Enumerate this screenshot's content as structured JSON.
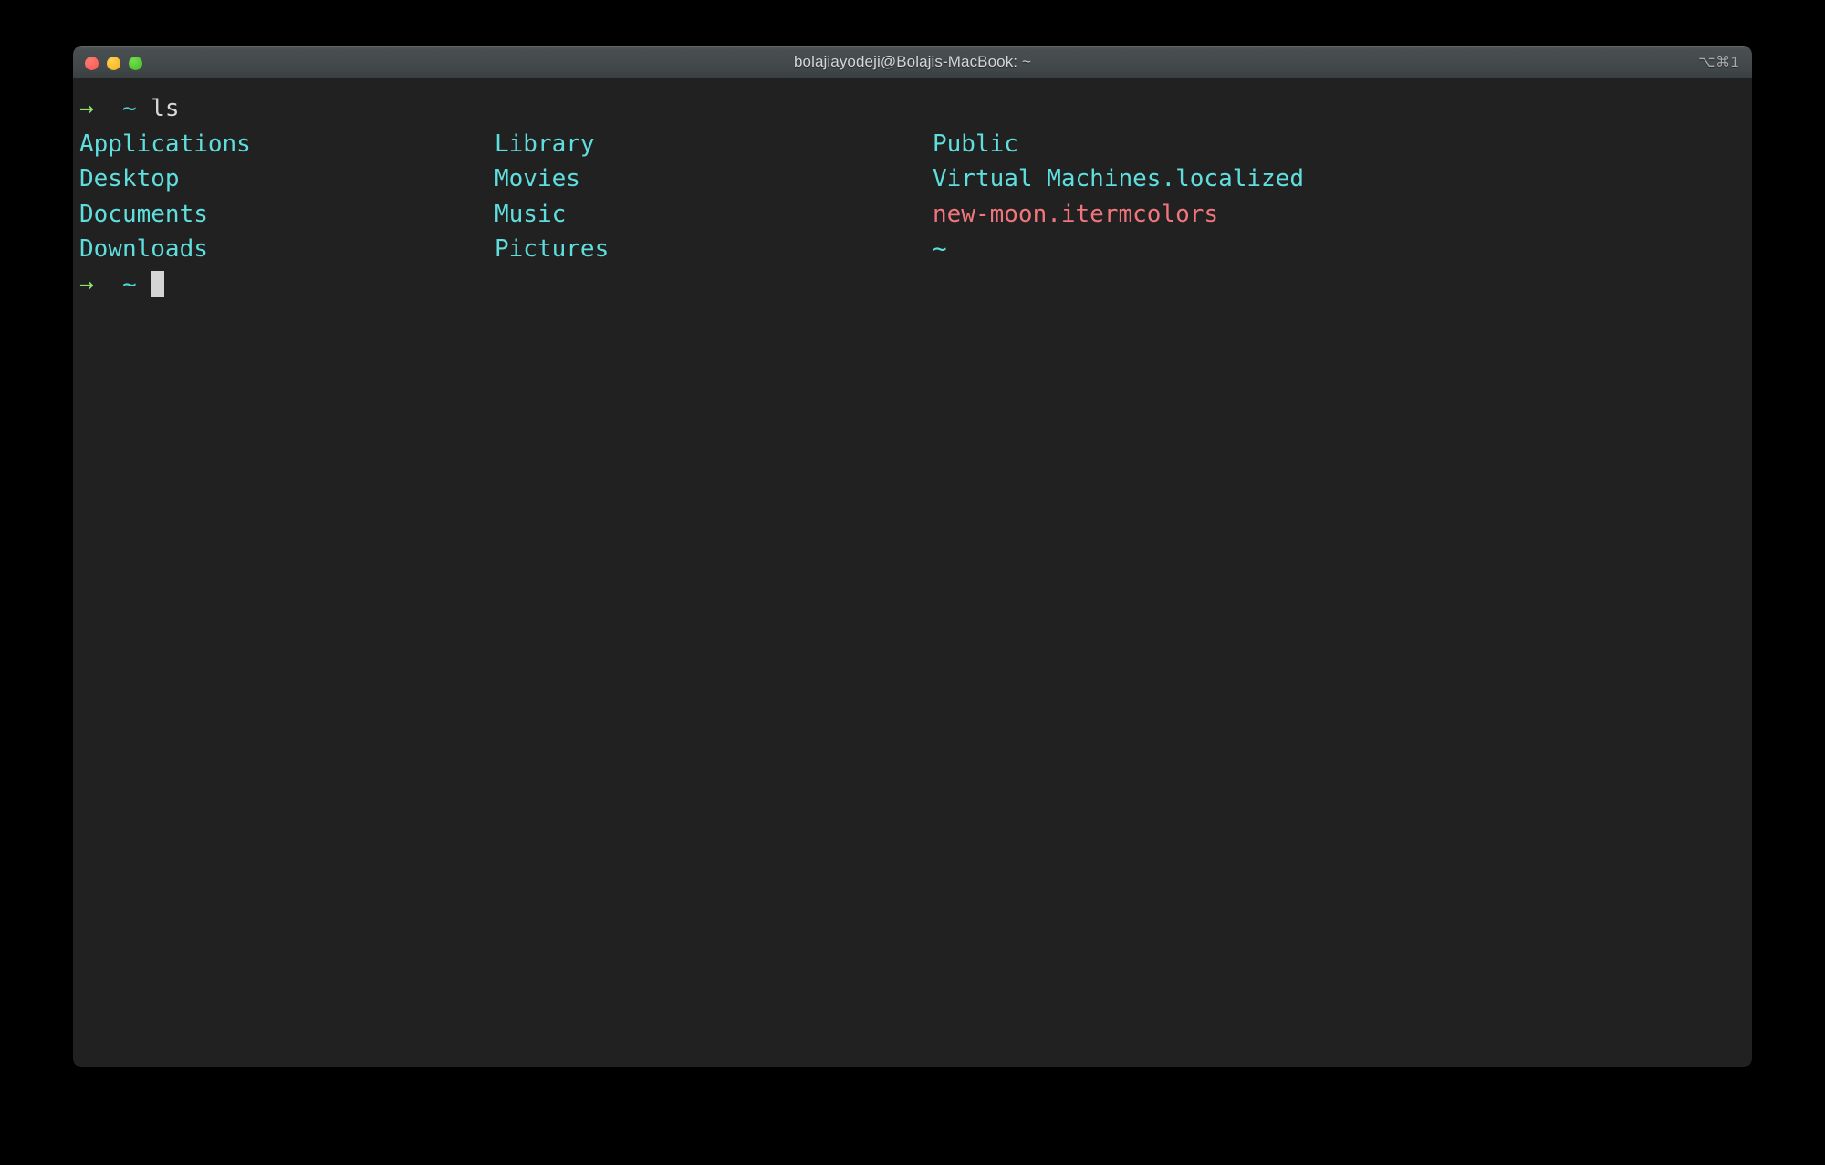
{
  "window": {
    "title": "bolajiayodeji@Bolajis-MacBook: ~",
    "hotkey_badge": "⌥⌘1",
    "traffic_lights": {
      "close_label": "close",
      "minimize_label": "minimize",
      "maximize_label": "maximize",
      "close_color": "#f9564f",
      "minimize_color": "#f2b01e",
      "maximize_color": "#41bb23"
    }
  },
  "terminal": {
    "background_color": "#212121",
    "colors": {
      "arrow": "#8fe472",
      "tilde": "#4fd6d6",
      "command": "#d6d9da",
      "directory": "#5fdede",
      "file": "#f0757c"
    },
    "command_line": {
      "arrow": "→",
      "path": "~",
      "command": "ls"
    },
    "ls_output": {
      "columns": [
        [
          "Applications",
          "Desktop",
          "Documents",
          "Downloads"
        ],
        [
          "Library",
          "Movies",
          "Music",
          "Pictures"
        ],
        [
          "Public",
          "Virtual Machines.localized",
          "new-moon.itermcolors",
          "~"
        ]
      ],
      "entry_types": [
        [
          "dir",
          "dir",
          "dir",
          "dir"
        ],
        [
          "dir",
          "dir",
          "dir",
          "dir"
        ],
        [
          "dir",
          "dir",
          "file",
          "dir"
        ]
      ]
    },
    "prompt_line": {
      "arrow": "→",
      "path": "~",
      "input": ""
    }
  }
}
